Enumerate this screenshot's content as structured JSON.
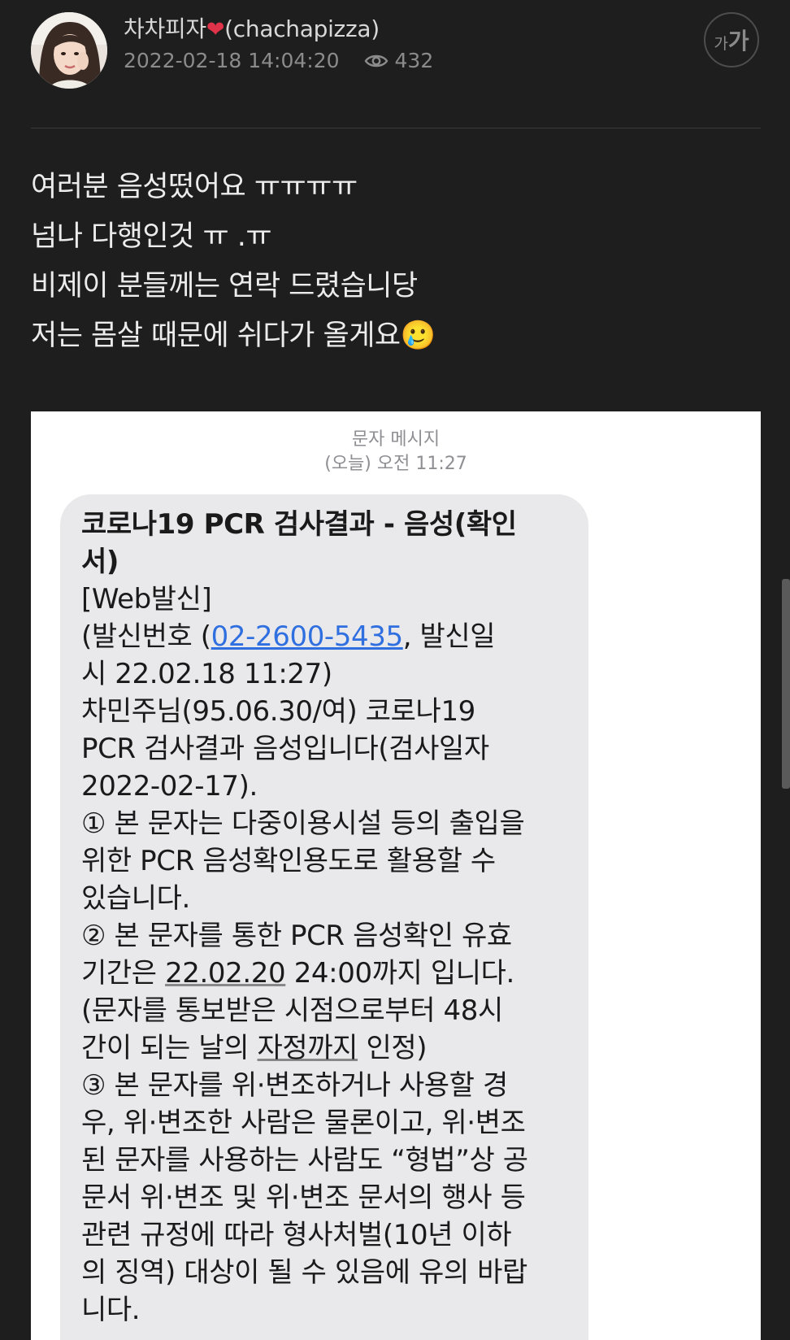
{
  "post": {
    "author_name": "차차피자",
    "author_handle": "(chachapizza)",
    "date": "2022-02-18 14:04:20",
    "views": "432",
    "font_size_small": "가",
    "font_size_big": "가",
    "lines": [
      "여러분 음성떴어요 ㅠㅠㅠㅠ",
      "넘나 다행인것 ㅠ .ㅠ",
      "비제이 분들께는 연락 드렸습니당",
      "저는 몸살 때문에 쉬다가 올게요"
    ],
    "emoji": "🥲"
  },
  "sms": {
    "header_title": "문자 메시지",
    "header_time": "(오늘) 오전 11:27",
    "title_line1": "코로나19 PCR 검사결과 - 음성(확인",
    "title_line2": "서)",
    "line3": "[Web발신]",
    "line4_prefix": "(발신번호 (",
    "phone": "02-2600-5435",
    "line4_suffix": ", 발신일",
    "line5": "시 22.02.18 11:27)",
    "line6": "차민주님(95.06.30/여) 코로나19",
    "line7": "PCR 검사결과 음성입니다(검사일자",
    "line8": "2022-02-17).",
    "line9": "① 본 문자는 다중이용시설 등의 출입을",
    "line10": "위한 PCR 음성확인용도로 활용할 수",
    "line11": "있습니다.",
    "line12": "② 본 문자를 통한 PCR 음성확인 유효",
    "line13_prefix": "기간은 ",
    "line13_date": "22.02.20",
    "line13_suffix": " 24:00까지 입니다.",
    "line14": "(문자를 통보받은 시점으로부터 48시",
    "line15_prefix": "간이 되는 날의 ",
    "line15_ul": "자정까지",
    "line15_suffix": " 인정)",
    "line16": "③ 본 문자를 위·변조하거나 사용할 경",
    "line17": "우, 위·변조한 사람은 물론이고, 위·변조",
    "line18": "된 문자를 사용하는 사람도 “형법”상 공",
    "line19": "문서 위·변조 및 위·변조 문서의 행사 등",
    "line20": "관련 규정에 따라 형사처벌(10년 이하",
    "line21": "의 징역) 대상이 될 수 있음에 유의 바랍",
    "line22": "니다."
  },
  "colors": {
    "background": "#1e1e1e",
    "link": "#2f6fe0",
    "bubble": "#e9e9eb",
    "heart": "#e0334a"
  },
  "icons": [
    "avatar-image",
    "heart-icon",
    "eye-icon",
    "font-size-icon",
    "crying-smile-emoji"
  ]
}
